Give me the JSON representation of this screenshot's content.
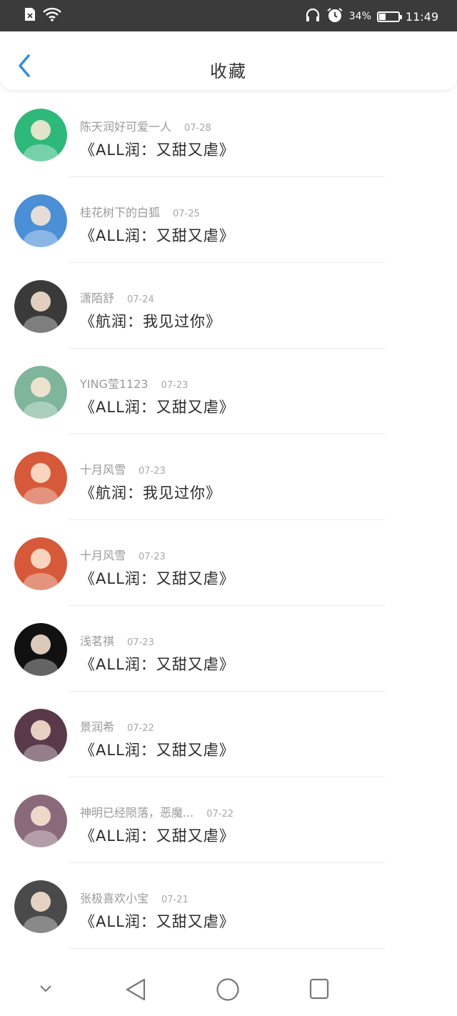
{
  "status_bar": {
    "battery_percent": "34%",
    "battery_level": 0.34,
    "time": "11:49",
    "icons": [
      "sim-icon",
      "wifi-icon",
      "headphones-icon",
      "alarm-icon",
      "battery-icon"
    ]
  },
  "header": {
    "title": "收藏",
    "back_icon": "chevron-left-icon",
    "accent": "#2f8fe6"
  },
  "items": [
    {
      "author": "陈天润好可爱一人",
      "date": "07-28",
      "title": "《ALL润：又甜又虐》",
      "avatar_color": "#2eb87a"
    },
    {
      "author": "桂花树下的白狐",
      "date": "07-25",
      "title": "《ALL润：又甜又虐》",
      "avatar_color": "#4b8fd6"
    },
    {
      "author": "潇陌舒",
      "date": "07-24",
      "title": "《航润：我见过你》",
      "avatar_color": "#3a3a3a"
    },
    {
      "author": "YING莹1123",
      "date": "07-23",
      "title": "《ALL润：又甜又虐》",
      "avatar_color": "#7fb59a"
    },
    {
      "author": "十月风雪",
      "date": "07-23",
      "title": "《航润：我见过你》",
      "avatar_color": "#d65a3a"
    },
    {
      "author": "十月风雪",
      "date": "07-23",
      "title": "《ALL润：又甜又虐》",
      "avatar_color": "#d65a3a"
    },
    {
      "author": "浅茗祺",
      "date": "07-23",
      "title": "《ALL润：又甜又虐》",
      "avatar_color": "#111111"
    },
    {
      "author": "景润希",
      "date": "07-22",
      "title": "《ALL润：又甜又虐》",
      "avatar_color": "#5a3a4a"
    },
    {
      "author": "神明已经陨落，恶魔...",
      "date": "07-22",
      "title": "《ALL润：又甜又虐》",
      "avatar_color": "#8a6a7a"
    },
    {
      "author": "张极喜欢小宝",
      "date": "07-21",
      "title": "《ALL润：又甜又虐》",
      "avatar_color": "#4a4a4a"
    }
  ],
  "nav": {
    "icons": [
      "collapse-icon",
      "back-triangle-icon",
      "home-circle-icon",
      "recents-square-icon"
    ]
  }
}
